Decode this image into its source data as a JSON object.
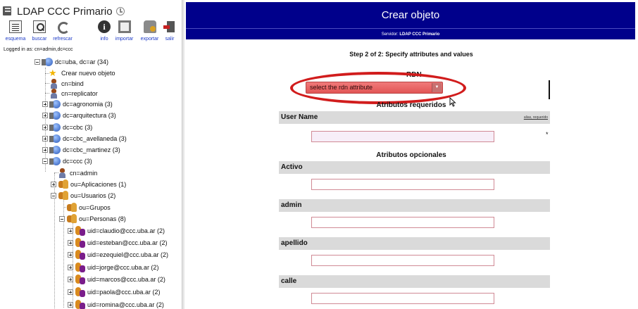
{
  "sidebar": {
    "server_title": "LDAP CCC Primario",
    "toolbar": [
      {
        "label": "esquema",
        "icon": "schema-icon"
      },
      {
        "label": "buscar",
        "icon": "search-icon"
      },
      {
        "label": "refrescar",
        "icon": "refresh-icon"
      },
      {
        "label": "info",
        "icon": "info-icon"
      },
      {
        "label": "importar",
        "icon": "import-icon"
      },
      {
        "label": "exportar",
        "icon": "export-icon"
      },
      {
        "label": "salir",
        "icon": "logout-icon"
      }
    ],
    "logged_in": "Logged in as: cn=admin,dc=ccc",
    "tree": [
      {
        "label": "dc=uba, dc=ar (34)",
        "icon": "domain-icon"
      },
      {
        "label": "Crear nuevo objeto",
        "icon": "star-icon"
      },
      {
        "label": "cn=bind",
        "icon": "person-icon"
      },
      {
        "label": "cn=replicator",
        "icon": "person-icon"
      },
      {
        "label": "dc=agronomia (3)",
        "icon": "domain-icon"
      },
      {
        "label": "dc=arquitectura (3)",
        "icon": "domain-icon"
      },
      {
        "label": "dc=cbc (3)",
        "icon": "domain-icon"
      },
      {
        "label": "dc=cbc_avellaneda (3)",
        "icon": "domain-icon"
      },
      {
        "label": "dc=cbc_martinez (3)",
        "icon": "domain-icon"
      },
      {
        "label": "dc=ccc (3)",
        "icon": "domain-icon"
      },
      {
        "label": "cn=admin",
        "icon": "person-icon"
      },
      {
        "label": "ou=Aplicaciones (1)",
        "icon": "org-unit-icon"
      },
      {
        "label": "ou=Usuarios (2)",
        "icon": "org-unit-icon"
      },
      {
        "label": "ou=Grupos",
        "icon": "org-unit-icon"
      },
      {
        "label": "ou=Personas (8)",
        "icon": "org-unit-icon"
      },
      {
        "label": "uid=claudio@ccc.uba.ar (2)",
        "icon": "user-icon"
      },
      {
        "label": "uid=esteban@ccc.uba.ar (2)",
        "icon": "user-icon"
      },
      {
        "label": "uid=ezequiel@ccc.uba.ar (2)",
        "icon": "user-icon"
      },
      {
        "label": "uid=jorge@ccc.uba.ar (2)",
        "icon": "user-icon"
      },
      {
        "label": "uid=marcos@ccc.uba.ar (2)",
        "icon": "user-icon"
      },
      {
        "label": "uid=paola@ccc.uba.ar (2)",
        "icon": "user-icon"
      },
      {
        "label": "uid=romina@ccc.uba.ar (2)",
        "icon": "user-icon"
      }
    ]
  },
  "main": {
    "title": "Crear objeto",
    "server_prefix": "Servidor:",
    "server_name": "LDAP CCC Primario",
    "step": "Step 2 of 2: Specify attributes and values",
    "rdn_label": "RDN",
    "rdn_select_value": "select the rdn attribute",
    "required_title": "Atributos requeridos",
    "required_hint": "alias, requerido",
    "required_attrs": [
      {
        "label": "User Name",
        "value": ""
      }
    ],
    "required_marker": "*",
    "optional_title": "Atributos opcionales",
    "optional_attrs": [
      {
        "label": "Activo",
        "value": ""
      },
      {
        "label": "admin",
        "value": ""
      },
      {
        "label": "apellido",
        "value": ""
      },
      {
        "label": "calle",
        "value": ""
      }
    ]
  },
  "colors": {
    "header_bg": "#00008b",
    "select_bg": "#e25555",
    "highlight_ellipse": "#d11c1c"
  }
}
